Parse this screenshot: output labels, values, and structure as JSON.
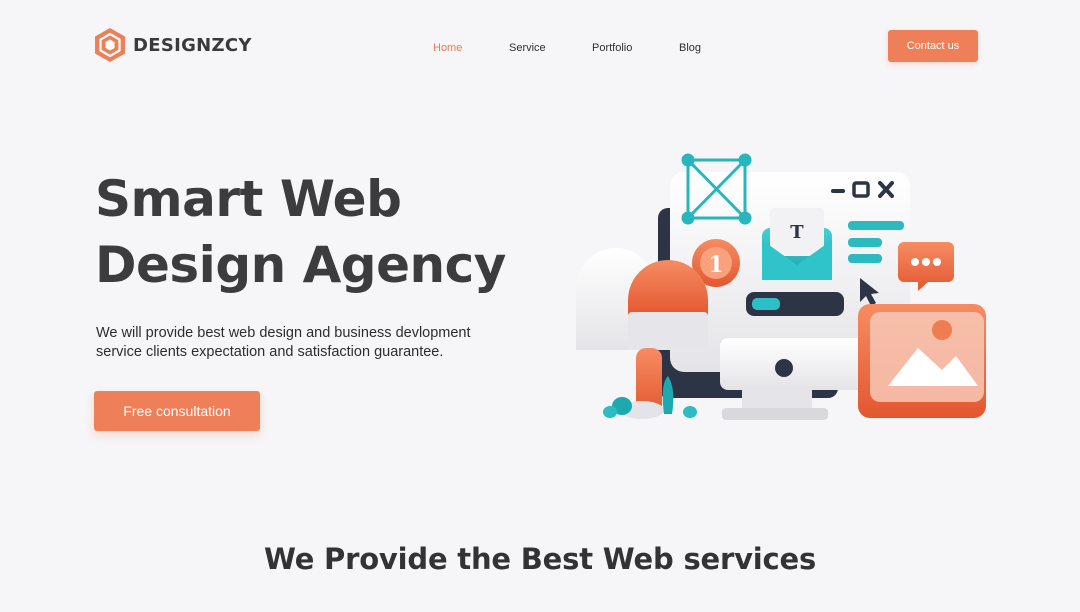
{
  "brand": {
    "name": "DESIGNZCY",
    "logo_icon": "hexagon-logo-icon",
    "accent_color": "#ef7f58",
    "teal_color": "#2cb9c0"
  },
  "nav": {
    "items": [
      {
        "label": "Home",
        "active": true
      },
      {
        "label": "Service",
        "active": false
      },
      {
        "label": "Portfolio",
        "active": false
      },
      {
        "label": "Blog",
        "active": false
      }
    ],
    "contact_label": "Contact us"
  },
  "hero": {
    "title_line1": "Smart Web",
    "title_line2": "Design Agency",
    "desc_line1": "We will provide best web design and business devlopment",
    "desc_line2": "service clients expectation and satisfaction guarantee.",
    "cta_label": "Free consultation",
    "illustration": {
      "badge_number": "1",
      "letter_card": "T",
      "window_controls": [
        "minimize-icon",
        "maximize-icon",
        "close-icon"
      ],
      "chat_icon": "chat-bubble-icon",
      "image_icon": "image-icon",
      "cursor_icon": "cursor-arrow-icon",
      "wireframe_icon": "wireframe-box-icon",
      "mailbox_icon": "mailbox-icon"
    }
  },
  "services": {
    "title": "We Provide the Best Web services"
  }
}
